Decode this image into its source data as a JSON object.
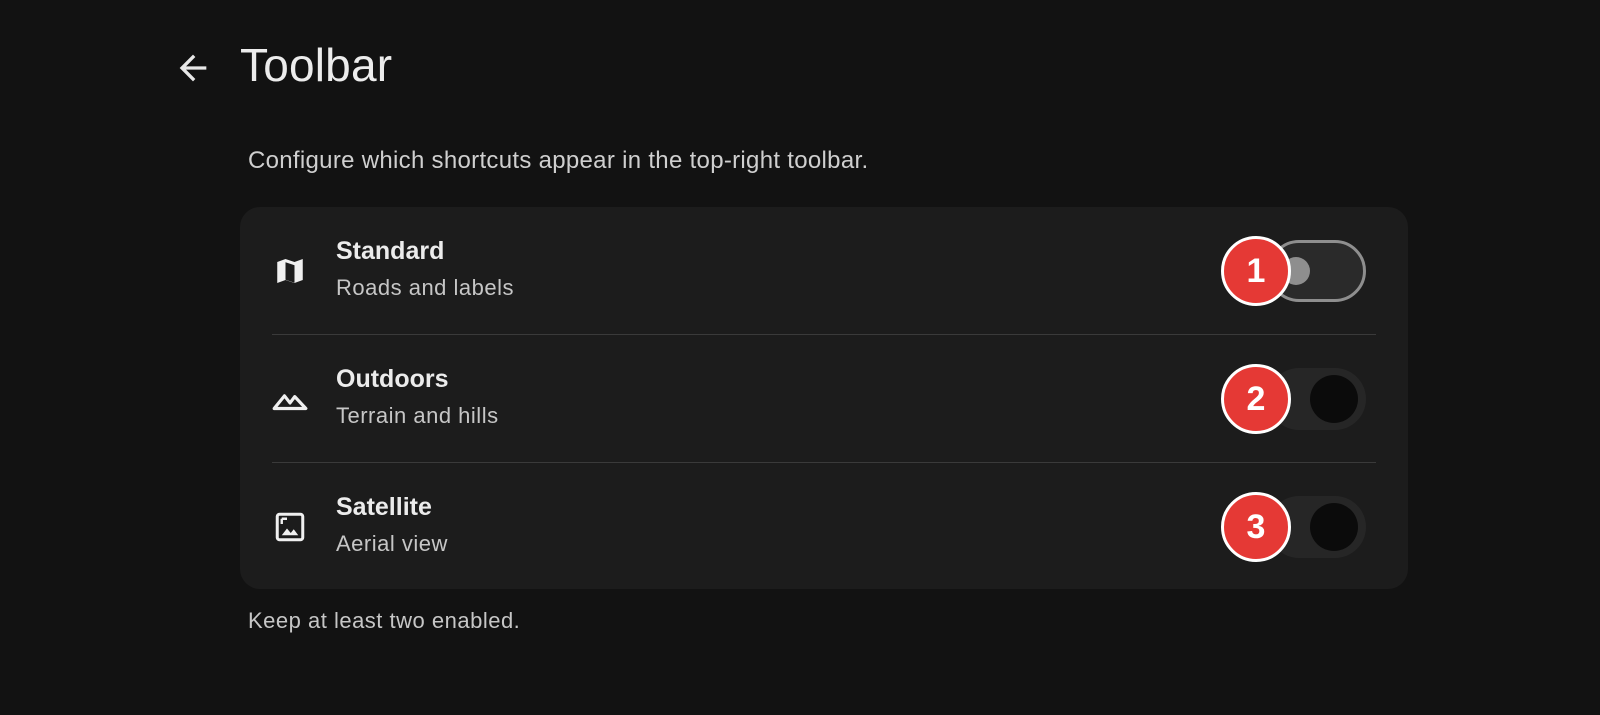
{
  "header": {
    "back_icon": "arrow-left-icon",
    "title": "Toolbar"
  },
  "description": "Configure which shortcuts appear in the top-right toolbar.",
  "options": [
    {
      "icon": "map-icon",
      "title": "Standard",
      "subtitle": "Roads and labels",
      "enabled": false,
      "marker": "1"
    },
    {
      "icon": "terrain-icon",
      "title": "Outdoors",
      "subtitle": "Terrain and hills",
      "enabled": true,
      "marker": "2"
    },
    {
      "icon": "image-icon",
      "title": "Satellite",
      "subtitle": "Aerial view",
      "enabled": true,
      "marker": "3"
    }
  ],
  "footer_note": "Keep at least two enabled.",
  "colors": {
    "background": "#121212",
    "card": "#1c1c1c",
    "marker": "#e53935"
  }
}
